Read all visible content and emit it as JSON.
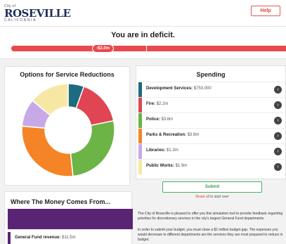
{
  "header": {
    "logo_kicker": "City of",
    "logo_main": "ROSEVILLE",
    "logo_sub": "CALIFORNIA",
    "help_label": "Help"
  },
  "deficit": {
    "title": "You are in deficit.",
    "badge": "-$2.0m"
  },
  "options": {
    "title": "Options for Service Reductions"
  },
  "chart_data": {
    "type": "pie",
    "categories": [
      "Development Services",
      "Fire",
      "Police",
      "Parks & Recreation",
      "Libraries",
      "Public Works"
    ],
    "values": [
      0.75,
      2.2,
      3.6,
      3.8,
      1.3,
      1.9
    ],
    "colors": [
      "#1d6b7e",
      "#e04553",
      "#6bb445",
      "#f58426",
      "#c7a9e8",
      "#f7e7a4"
    ]
  },
  "spending": {
    "title": "Spending",
    "items": [
      {
        "label": "Development Services:",
        "value": "$750,000",
        "color": "#1d6b7e"
      },
      {
        "label": "Fire:",
        "value": "$2.2m",
        "color": "#e04553"
      },
      {
        "label": "Police:",
        "value": "$3.6m",
        "color": "#6bb445"
      },
      {
        "label": "Parks & Recreation:",
        "value": "$3.8m",
        "color": "#f58426"
      },
      {
        "label": "Libraries:",
        "value": "$1.3m",
        "color": "#c7a9e8"
      },
      {
        "label": "Public Works:",
        "value": "$1.9m",
        "color": "#f7e7a4"
      }
    ]
  },
  "submit": {
    "label": "Submit",
    "reset_link": "Reset all",
    "reset_suffix": "to start over"
  },
  "intro": {
    "p1": "The City of Roseville is pleased to offer you this simulation tool to provide feedback regarding priorities for discretionary services in the city's largest General Fund departments.",
    "p2": "In order to submit your budget, you must close a $2 million budget gap. The expenses you would decrease to different departments are the services they are most prepared to reduce in budget."
  },
  "money": {
    "title": "Where The Money Comes From...",
    "row_label": "General Fund revenue:",
    "row_value": "$11.5m",
    "bar_color": "#5a2475"
  }
}
